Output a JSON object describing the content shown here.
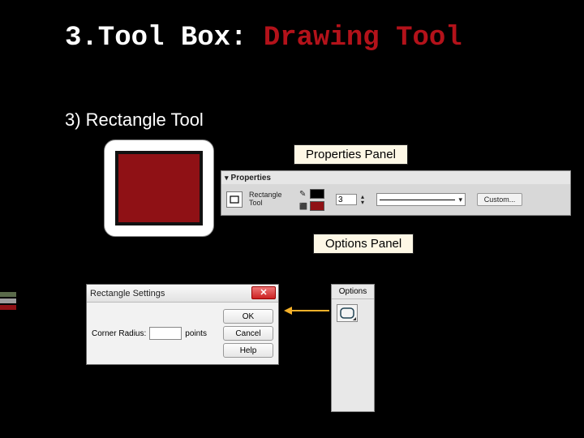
{
  "title": {
    "prefix": "3.Tool Box: ",
    "suffix": "Drawing Tool"
  },
  "subtitle": "3) Rectangle Tool",
  "labels": {
    "properties_panel": "Properties Panel",
    "options_panel": "Options Panel"
  },
  "properties": {
    "header": "Properties",
    "tool_name_line1": "Rectangle",
    "tool_name_line2": "Tool",
    "stroke_thickness": "3",
    "stroke_style": "Solid",
    "custom_button": "Custom..."
  },
  "options": {
    "header": "Options"
  },
  "dialog": {
    "title": "Rectangle Settings",
    "field_label": "Corner Radius:",
    "field_unit": "points",
    "buttons": {
      "ok": "OK",
      "cancel": "Cancel",
      "help": "Help"
    },
    "close_glyph": "✕"
  }
}
